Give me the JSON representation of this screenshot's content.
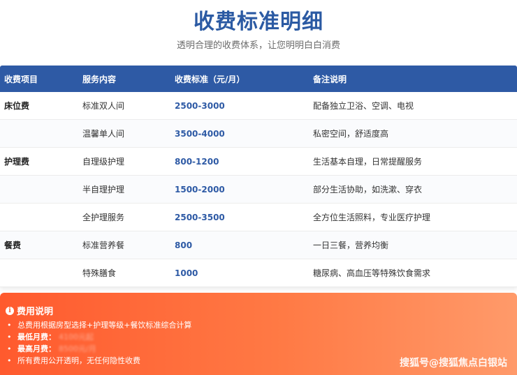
{
  "header": {
    "title": "收费标准明细",
    "subtitle": "透明合理的收费体系，让您明明白白消费"
  },
  "table": {
    "columns": [
      "收费项目",
      "服务内容",
      "收费标准（元/月）",
      "备注说明"
    ],
    "rows": [
      {
        "category": "床位费",
        "service": "标准双人间",
        "price": "2500-3000",
        "note": "配备独立卫浴、空调、电视"
      },
      {
        "category": "",
        "service": "温馨单人间",
        "price": "3500-4000",
        "note": "私密空间，舒适度高"
      },
      {
        "category": "护理费",
        "service": "自理级护理",
        "price": "800-1200",
        "note": "生活基本自理，日常提醒服务"
      },
      {
        "category": "",
        "service": "半自理护理",
        "price": "1500-2000",
        "note": "部分生活协助，如洗漱、穿衣"
      },
      {
        "category": "",
        "service": "全护理服务",
        "price": "2500-3500",
        "note": "全方位生活照料，专业医疗护理"
      },
      {
        "category": "餐费",
        "service": "标准营养餐",
        "price": "800",
        "note": "一日三餐，营养均衡"
      },
      {
        "category": "",
        "service": "特殊膳食",
        "price": "1000",
        "note": "糖尿病、高血压等特殊饮食需求"
      }
    ]
  },
  "notes": {
    "icon": "info-icon",
    "title": "费用说明",
    "items": [
      {
        "label": "",
        "text": "总费用根据房型选择+护理等级+餐饮标准综合计算"
      },
      {
        "label": "最低月费：",
        "text": "",
        "blurred": "4100元起"
      },
      {
        "label": "最高月费：",
        "text": "",
        "blurred": "8500元/月"
      },
      {
        "label": "",
        "text": "所有费用公开透明，无任何隐性收费"
      }
    ]
  },
  "watermark": "搜狐号@搜狐焦点白银站",
  "colors": {
    "primary": "#2e5aa5",
    "accent": "#ff6a3a"
  }
}
